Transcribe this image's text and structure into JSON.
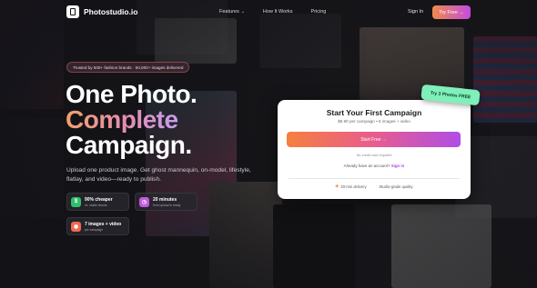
{
  "nav": {
    "brand": "Photostudio.io",
    "menu": [
      {
        "label": "Features",
        "chevron": "⌄"
      },
      {
        "label": "How It Works"
      },
      {
        "label": "Pricing"
      }
    ],
    "signin": "Sign In",
    "cta": "Try Free →"
  },
  "hero": {
    "trusted": "Trusted by 500+ fashion brands · 50,000+ images delivered",
    "line1": "One Photo.",
    "line2": "Complete",
    "line3": "Campaign.",
    "subtitle": "Upload one product image. Get ghost mannequin, on-model, lifestyle, flatlay, and video—ready to publish.",
    "features": [
      {
        "icon": "dollar-icon",
        "glyph": "$",
        "color": "#2fbf6b",
        "title": "90% cheaper",
        "caption": "vs. studio shoots"
      },
      {
        "icon": "clock-icon",
        "glyph": "◷",
        "color": "#c05ae0",
        "title": "20 minutes",
        "caption": "from upload to ready"
      },
      {
        "icon": "camera-icon",
        "glyph": "◉",
        "color": "#f06a4e",
        "title": "7 images + video",
        "caption": "per campaign"
      }
    ]
  },
  "card": {
    "badge": "Try 3 Photos FREE",
    "title": "Start Your First Campaign",
    "subtitle": "$9.90 per campaign • 6 images + video",
    "button": "Start Free →",
    "no_card": "No credit card required",
    "account_q": "Already have an account?",
    "account_link": "Sign in",
    "footer": [
      {
        "icon": "delivery-icon",
        "label": "20-min delivery"
      },
      {
        "icon": "quality-icon",
        "label": "Studio-grade quality"
      }
    ]
  },
  "colors": {
    "accent_start": "#f5803e",
    "accent_end": "#b04de6",
    "badge_green": "#7ff0b9"
  }
}
